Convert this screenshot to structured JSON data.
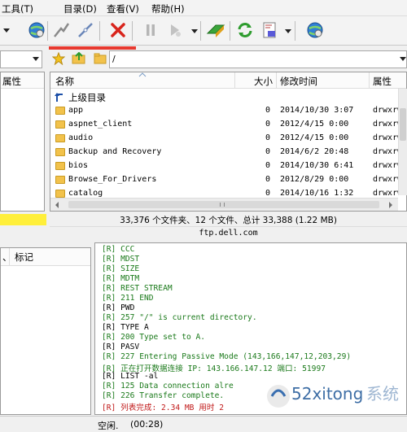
{
  "menubar": {
    "items": [
      "工具(T)",
      "目录(D)",
      "查看(V)",
      "帮助(H)"
    ]
  },
  "address": {
    "path": "/"
  },
  "left_pane": {
    "header_attr": "属性"
  },
  "file_list": {
    "columns": [
      "名称",
      "大小",
      "修改时间",
      "属性"
    ],
    "up_label": "上级目录",
    "rows": [
      {
        "name": "app",
        "size": "0",
        "date": "2014/10/30 3:07",
        "attr": "drwxrw"
      },
      {
        "name": "aspnet_client",
        "size": "0",
        "date": "2012/4/15 0:00",
        "attr": "drwxrw"
      },
      {
        "name": "audio",
        "size": "0",
        "date": "2012/4/15 0:00",
        "attr": "drwxrw"
      },
      {
        "name": "Backup and Recovery",
        "size": "0",
        "date": "2014/6/2 20:48",
        "attr": "drwxrw"
      },
      {
        "name": "bios",
        "size": "0",
        "date": "2014/10/30 6:41",
        "attr": "drwxrw"
      },
      {
        "name": "Browse_For_Drivers",
        "size": "0",
        "date": "2012/8/29 0:00",
        "attr": "drwxrw"
      },
      {
        "name": "catalog",
        "size": "0",
        "date": "2014/10/16 1:32",
        "attr": "drwxrw"
      }
    ],
    "summary": "33,376 个文件夹、12 个文件、总计 33,388 (1.22 MB)",
    "host": "ftp.dell.com"
  },
  "queue": {
    "header_left": "、",
    "header_tag": "标记"
  },
  "log": {
    "lines": [
      {
        "text": "[R] CCC",
        "color": "#1b7a1b"
      },
      {
        "text": "[R] MDST",
        "color": "#1b7a1b"
      },
      {
        "text": "[R] SIZE",
        "color": "#1b7a1b"
      },
      {
        "text": "[R] MDTM",
        "color": "#1b7a1b"
      },
      {
        "text": "[R] REST STREAM",
        "color": "#1b7a1b"
      },
      {
        "text": "[R] 211 END",
        "color": "#1b7a1b"
      },
      {
        "text": "[R] PWD",
        "color": "#000000"
      },
      {
        "text": "[R] 257 \"/\" is current directory.",
        "color": "#1b7a1b"
      },
      {
        "text": "[R] TYPE A",
        "color": "#000000"
      },
      {
        "text": "[R] 200 Type set to A.",
        "color": "#1b7a1b"
      },
      {
        "text": "[R] PASV",
        "color": "#000000"
      },
      {
        "text": "[R] 227 Entering Passive Mode (143,166,147,12,203,29)",
        "color": "#1b7a1b"
      },
      {
        "text": "[R] 正在打开数据连接 IP: 143.166.147.12 端口: 51997",
        "color": "#1b7a1b"
      },
      {
        "text": "[R] LIST -al",
        "color": "#000000"
      },
      {
        "text": "[R] 125 Data connection alre",
        "color": "#1b7a1b"
      },
      {
        "text": "[R] 226 Transfer complete.",
        "color": "#1b7a1b"
      },
      {
        "text": "[R] 列表完成: 2.34 MB 用时 2",
        "color": "#c01818"
      }
    ]
  },
  "status": {
    "state": "空闲.",
    "time": "(00:28)"
  }
}
